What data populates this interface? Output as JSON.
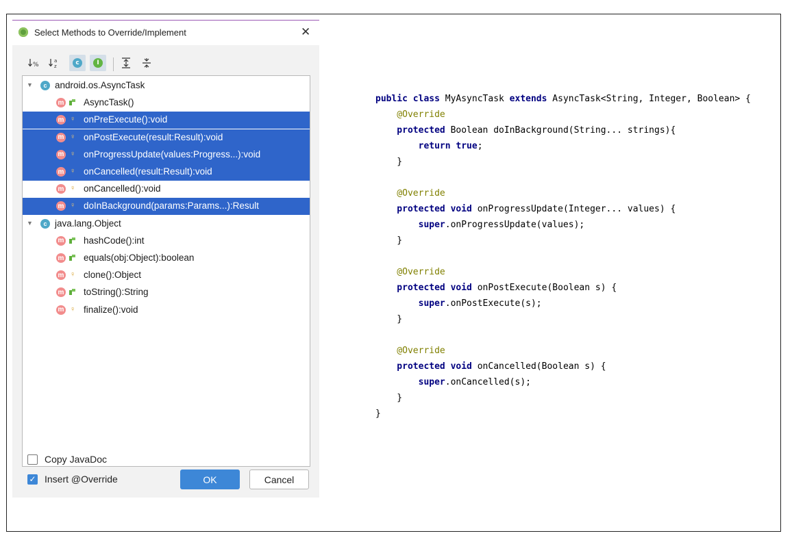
{
  "dialog": {
    "title": "Select Methods to Override/Implement",
    "close": "✕",
    "toolbar": [
      {
        "name": "sort-by-visibility-icon",
        "glyph": "↓%",
        "active": false
      },
      {
        "name": "sort-alphabetically-icon",
        "glyph": "↓ª",
        "active": false
      },
      {
        "name": "show-classes-icon",
        "glyph": "c",
        "active": true
      },
      {
        "name": "show-interfaces-icon",
        "glyph": "I",
        "active": true
      },
      {
        "name": "expand-all-icon",
        "glyph": "≚",
        "active": false
      },
      {
        "name": "collapse-all-icon",
        "glyph": "≛",
        "active": false
      }
    ],
    "tree": [
      {
        "type": "class",
        "label": "android.os.AsyncTask",
        "arrow": "▼",
        "icon": "c",
        "selected": false
      },
      {
        "type": "method",
        "label": "AsyncTask()",
        "icon": "m",
        "vis": "public",
        "selected": false
      },
      {
        "type": "method",
        "label": "onPreExecute():void",
        "icon": "m",
        "vis": "protected",
        "selected": true
      },
      {
        "type": "method",
        "label": "onPostExecute(result:Result):void",
        "icon": "m",
        "vis": "protected",
        "selected": true
      },
      {
        "type": "method",
        "label": "onProgressUpdate(values:Progress...):void",
        "icon": "m",
        "vis": "protected",
        "selected": true
      },
      {
        "type": "method",
        "label": "onCancelled(result:Result):void",
        "icon": "m",
        "vis": "protected",
        "selected": true
      },
      {
        "type": "method",
        "label": "onCancelled():void",
        "icon": "m",
        "vis": "protected",
        "selected": false
      },
      {
        "type": "method",
        "label": "doInBackground(params:Params...):Result",
        "icon": "m",
        "vis": "protected",
        "selected": true
      },
      {
        "type": "class",
        "label": "java.lang.Object",
        "arrow": "▼",
        "icon": "c",
        "selected": false
      },
      {
        "type": "method",
        "label": "hashCode():int",
        "icon": "m",
        "vis": "public",
        "selected": false
      },
      {
        "type": "method",
        "label": "equals(obj:Object):boolean",
        "icon": "m",
        "vis": "public",
        "selected": false
      },
      {
        "type": "method",
        "label": "clone():Object",
        "icon": "m",
        "vis": "protected",
        "selected": false
      },
      {
        "type": "method",
        "label": "toString():String",
        "icon": "m",
        "vis": "public",
        "selected": false
      },
      {
        "type": "method",
        "label": "finalize():void",
        "icon": "m",
        "vis": "protected",
        "selected": false
      }
    ],
    "copy_javadoc": {
      "label": "Copy JavaDoc",
      "checked": false
    },
    "insert_override": {
      "label": "Insert @Override",
      "checked": true
    },
    "ok_label": "OK",
    "cancel_label": "Cancel",
    "colors": {
      "selection": "#2f65ca",
      "ok_button": "#3d87d7",
      "method_icon": "#f28c8c",
      "class_icon": "#4fa8c8"
    }
  },
  "code": {
    "lines": [
      [
        {
          "t": "public class ",
          "c": "kw"
        },
        {
          "t": "MyAsyncTask "
        },
        {
          "t": "extends ",
          "c": "kw"
        },
        {
          "t": "AsyncTask<String, Integer, Boolean> {"
        }
      ],
      [
        {
          "t": "    @Override",
          "c": "ann"
        }
      ],
      [
        {
          "t": "    protected ",
          "c": "kw"
        },
        {
          "t": "Boolean doInBackground(String... strings){"
        }
      ],
      [
        {
          "t": "        return true",
          "c": "kw"
        },
        {
          "t": ";"
        }
      ],
      [
        {
          "t": "    }"
        }
      ],
      [
        {
          "t": ""
        }
      ],
      [
        {
          "t": "    @Override",
          "c": "ann"
        }
      ],
      [
        {
          "t": "    protected void ",
          "c": "kw"
        },
        {
          "t": "onProgressUpdate(Integer... values) {"
        }
      ],
      [
        {
          "t": "        super",
          "c": "kw"
        },
        {
          "t": ".onProgressUpdate(values);"
        }
      ],
      [
        {
          "t": "    }"
        }
      ],
      [
        {
          "t": ""
        }
      ],
      [
        {
          "t": "    @Override",
          "c": "ann"
        }
      ],
      [
        {
          "t": "    protected void ",
          "c": "kw"
        },
        {
          "t": "onPostExecute(Boolean s) {"
        }
      ],
      [
        {
          "t": "        super",
          "c": "kw"
        },
        {
          "t": ".onPostExecute(s);"
        }
      ],
      [
        {
          "t": "    }"
        }
      ],
      [
        {
          "t": ""
        }
      ],
      [
        {
          "t": "    @Override",
          "c": "ann"
        }
      ],
      [
        {
          "t": "    protected void ",
          "c": "kw"
        },
        {
          "t": "onCancelled(Boolean s) {"
        }
      ],
      [
        {
          "t": "        super",
          "c": "kw"
        },
        {
          "t": ".onCancelled(s);"
        }
      ],
      [
        {
          "t": "    }"
        }
      ],
      [
        {
          "t": "}"
        }
      ]
    ]
  }
}
